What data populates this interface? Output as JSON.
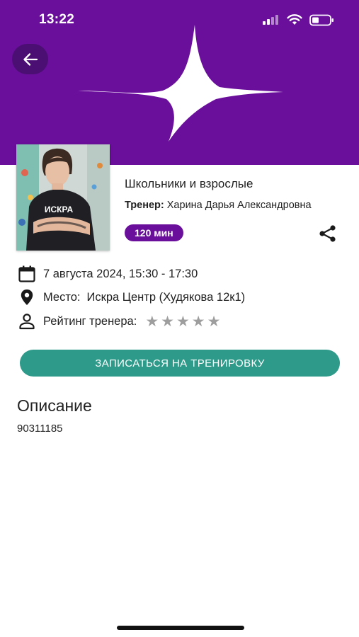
{
  "status_bar": {
    "time": "13:22"
  },
  "header": {
    "background_color": "#6a0f9b",
    "back_icon": "arrow-left-icon"
  },
  "training": {
    "title": "Школьники и взрослые",
    "trainer_label": "Тренер:",
    "trainer_name": "Харина Дарья Александровна",
    "duration": "120 мин"
  },
  "details": {
    "date": "7 августа 2024, 15:30 - 17:30",
    "place_label": "Место:",
    "place_value": "Искра Центр (Худякова 12к1)",
    "rating_label": "Рейтинг тренера:",
    "rating_stars_total": 5,
    "rating_stars_filled": 0
  },
  "photo": {
    "shirt_text": "ИСКРА"
  },
  "actions": {
    "signup_label": "ЗАПИСАТЬСЯ НА ТРЕНИРОВКУ",
    "signup_color": "#2e9a8a"
  },
  "description": {
    "title": "Описание",
    "text": "90311185"
  }
}
